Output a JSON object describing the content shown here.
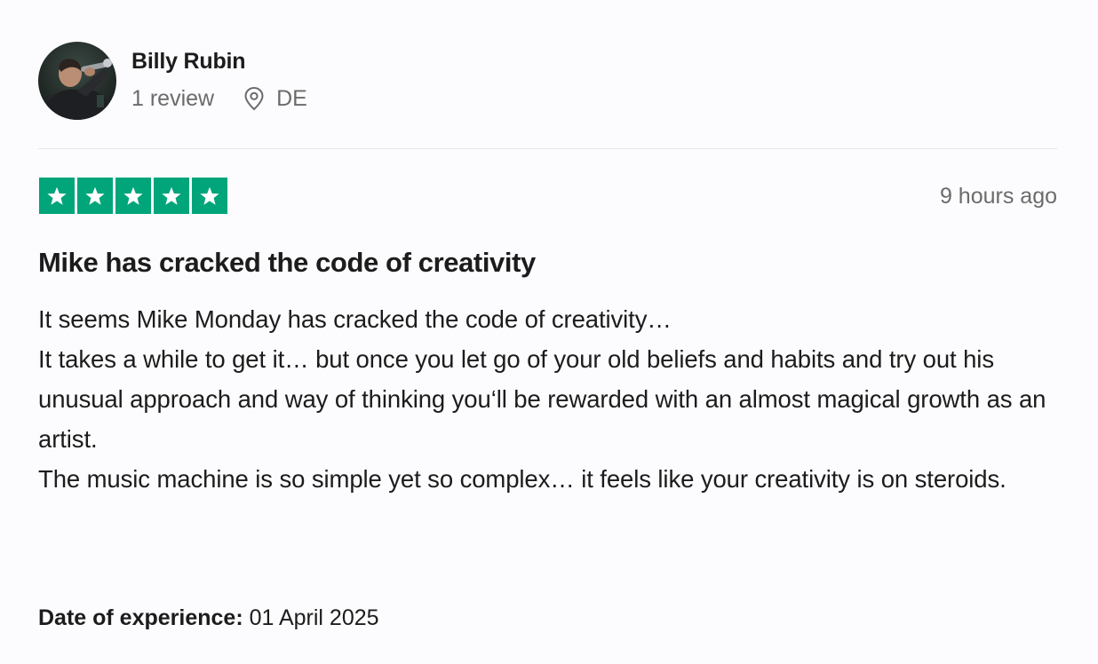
{
  "reviewer": {
    "name": "Billy Rubin",
    "review_count": "1 review",
    "location": "DE",
    "avatar_icon": "user-avatar-photo",
    "location_icon": "location-pin-icon"
  },
  "rating": {
    "stars": 5,
    "max_stars": 5,
    "star_color": "#00a57a",
    "star_icon": "star-icon"
  },
  "timestamp": "9 hours ago",
  "review": {
    "title": "Mike has cracked the code of creativity",
    "paragraphs": [
      "It seems Mike Monday has cracked the code of creativity…",
      "It takes a while to get it… but once you let go of your old beliefs and habits and try out his unusual approach and way of thinking you‘ll be rewarded with an almost magical growth as an artist.",
      "The music machine is so simple yet so complex… it feels like your creativity is on steroids."
    ]
  },
  "experience": {
    "label": "Date of experience:",
    "date": "01 April 2025"
  }
}
